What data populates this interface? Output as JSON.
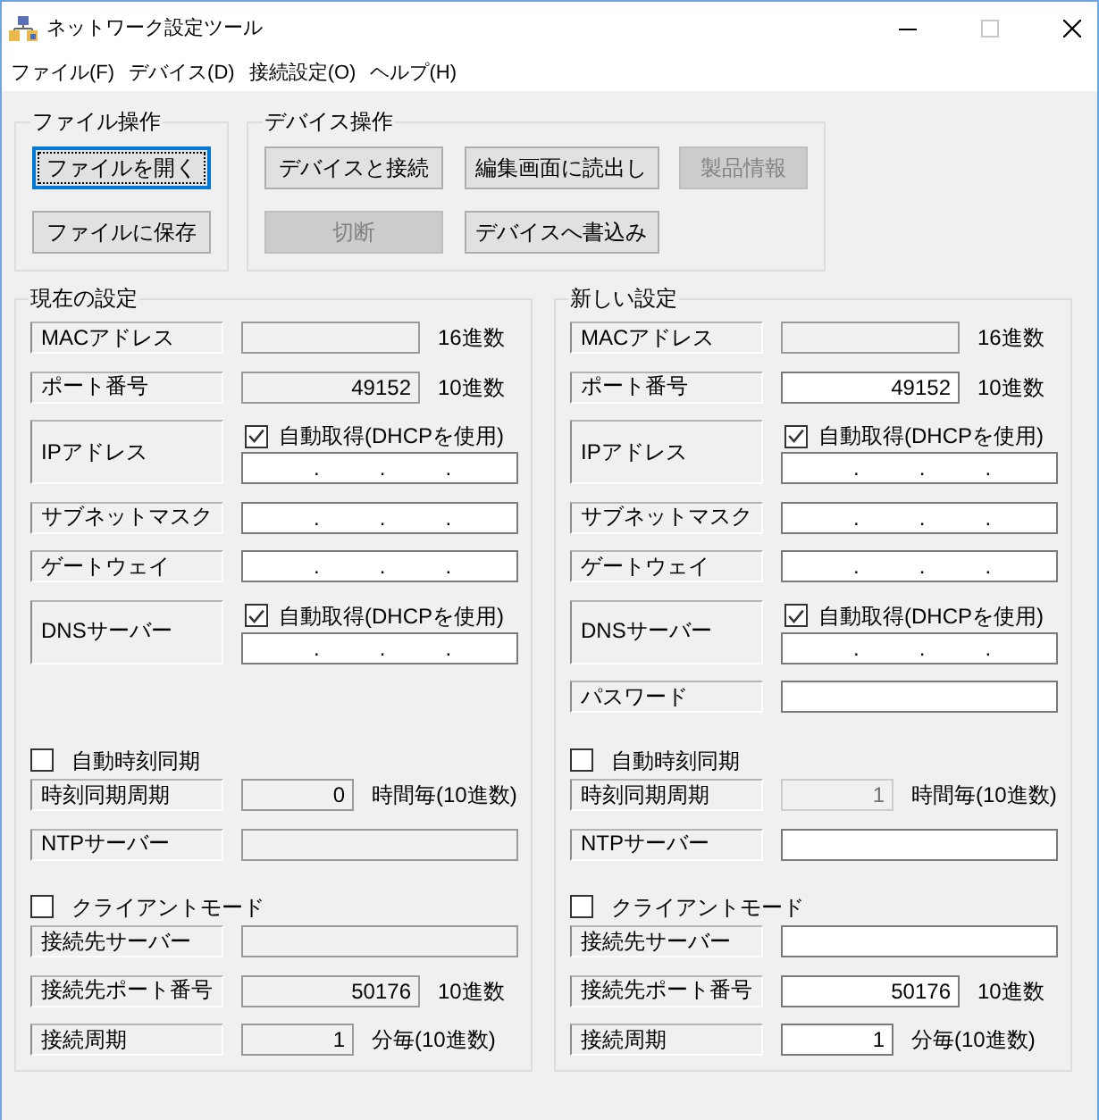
{
  "window": {
    "title": "ネットワーク設定ツール",
    "buttons": [
      {
        "kind": "minimize",
        "disabled": false
      },
      {
        "kind": "maximize",
        "disabled": true
      },
      {
        "kind": "close",
        "disabled": false
      }
    ]
  },
  "menu": [
    "ファイル(F)",
    "デバイス(D)",
    "接続設定(O)",
    "ヘルプ(H)"
  ],
  "file_operations": {
    "title": "ファイル操作",
    "buttons": [
      {
        "label": "ファイルを開く",
        "focused": true,
        "disabled": false
      },
      {
        "label": "ファイルに保存",
        "focused": false,
        "disabled": false
      }
    ]
  },
  "device_operations": {
    "title": "デバイス操作",
    "buttons": [
      {
        "label": "デバイスと接続",
        "focused": false,
        "disabled": false
      },
      {
        "label": "編集画面に読出し",
        "focused": false,
        "disabled": false
      },
      {
        "label": "製品情報",
        "focused": false,
        "disabled": true
      },
      {
        "label": "切断",
        "focused": false,
        "disabled": true
      },
      {
        "label": "デバイスへ書込み",
        "focused": false,
        "disabled": false
      }
    ]
  },
  "settings": [
    {
      "title": "現在の設定",
      "sections": [
        {
          "kind": "network",
          "rows": [
            {
              "kind": "value",
              "label": "MACアドレス",
              "readonly": true,
              "disabled": false,
              "unit": "16進数"
            },
            {
              "kind": "value",
              "label": "ポート番号",
              "readonly": true,
              "disabled": false,
              "value": "49152",
              "unit": "10進数"
            },
            {
              "kind": "ip_dhcp",
              "label": "IPアドレス",
              "option": "自動取得(DHCPを使用)",
              "checked": true,
              "readonly": false,
              "disabled": false,
              "separators": [
                ".",
                ".",
                "."
              ]
            },
            {
              "kind": "ip",
              "label": "サブネットマスク",
              "readonly": false,
              "disabled": false,
              "separators": [
                ".",
                ".",
                "."
              ]
            },
            {
              "kind": "ip",
              "label": "ゲートウェイ",
              "readonly": false,
              "disabled": false,
              "separators": [
                ".",
                ".",
                "."
              ]
            },
            {
              "kind": "ip_dhcp",
              "label": "DNSサーバー",
              "option": "自動取得(DHCPを使用)",
              "checked": true,
              "readonly": false,
              "disabled": false,
              "separators": [
                ".",
                ".",
                "."
              ]
            }
          ]
        },
        {
          "kind": "toggle",
          "label": "自動時刻同期",
          "checked": false,
          "rows": [
            {
              "kind": "count",
              "label": "時刻同期周期",
              "readonly": true,
              "disabled": false,
              "value": "0",
              "unit": "時間毎(10進数)"
            },
            {
              "kind": "text",
              "label": "NTPサーバー",
              "readonly": true,
              "disabled": false
            }
          ]
        },
        {
          "kind": "toggle",
          "label": "クライアントモード",
          "checked": false,
          "rows": [
            {
              "kind": "text",
              "label": "接続先サーバー",
              "readonly": true,
              "disabled": false
            },
            {
              "kind": "value",
              "label": "接続先ポート番号",
              "readonly": true,
              "disabled": false,
              "value": "50176",
              "unit": "10進数"
            },
            {
              "kind": "count",
              "label": "接続周期",
              "readonly": true,
              "disabled": false,
              "value": "1",
              "unit": "分毎(10進数)"
            }
          ]
        }
      ]
    },
    {
      "title": "新しい設定",
      "sections": [
        {
          "kind": "network",
          "rows": [
            {
              "kind": "value",
              "label": "MACアドレス",
              "readonly": true,
              "disabled": false,
              "unit": "16進数"
            },
            {
              "kind": "value",
              "label": "ポート番号",
              "readonly": false,
              "disabled": false,
              "value": "49152",
              "unit": "10進数"
            },
            {
              "kind": "ip_dhcp",
              "label": "IPアドレス",
              "option": "自動取得(DHCPを使用)",
              "checked": true,
              "readonly": false,
              "disabled": false,
              "separators": [
                ".",
                ".",
                "."
              ]
            },
            {
              "kind": "ip",
              "label": "サブネットマスク",
              "readonly": false,
              "disabled": false,
              "separators": [
                ".",
                ".",
                "."
              ]
            },
            {
              "kind": "ip",
              "label": "ゲートウェイ",
              "readonly": false,
              "disabled": false,
              "separators": [
                ".",
                ".",
                "."
              ]
            },
            {
              "kind": "ip_dhcp",
              "label": "DNSサーバー",
              "option": "自動取得(DHCPを使用)",
              "checked": true,
              "readonly": false,
              "disabled": false,
              "separators": [
                ".",
                ".",
                "."
              ]
            },
            {
              "kind": "text",
              "label": "パスワード",
              "readonly": false,
              "disabled": false
            }
          ]
        },
        {
          "kind": "toggle",
          "label": "自動時刻同期",
          "checked": false,
          "rows": [
            {
              "kind": "count",
              "label": "時刻同期周期",
              "readonly": false,
              "disabled": true,
              "value": "1",
              "unit": "時間毎(10進数)"
            },
            {
              "kind": "text",
              "label": "NTPサーバー",
              "readonly": false,
              "disabled": false
            }
          ]
        },
        {
          "kind": "toggle",
          "label": "クライアントモード",
          "checked": false,
          "rows": [
            {
              "kind": "text",
              "label": "接続先サーバー",
              "readonly": false,
              "disabled": false
            },
            {
              "kind": "value",
              "label": "接続先ポート番号",
              "readonly": false,
              "disabled": false,
              "value": "50176",
              "unit": "10進数"
            },
            {
              "kind": "count",
              "label": "接続周期",
              "readonly": false,
              "disabled": false,
              "value": "1",
              "unit": "分毎(10進数)"
            }
          ]
        }
      ]
    }
  ]
}
